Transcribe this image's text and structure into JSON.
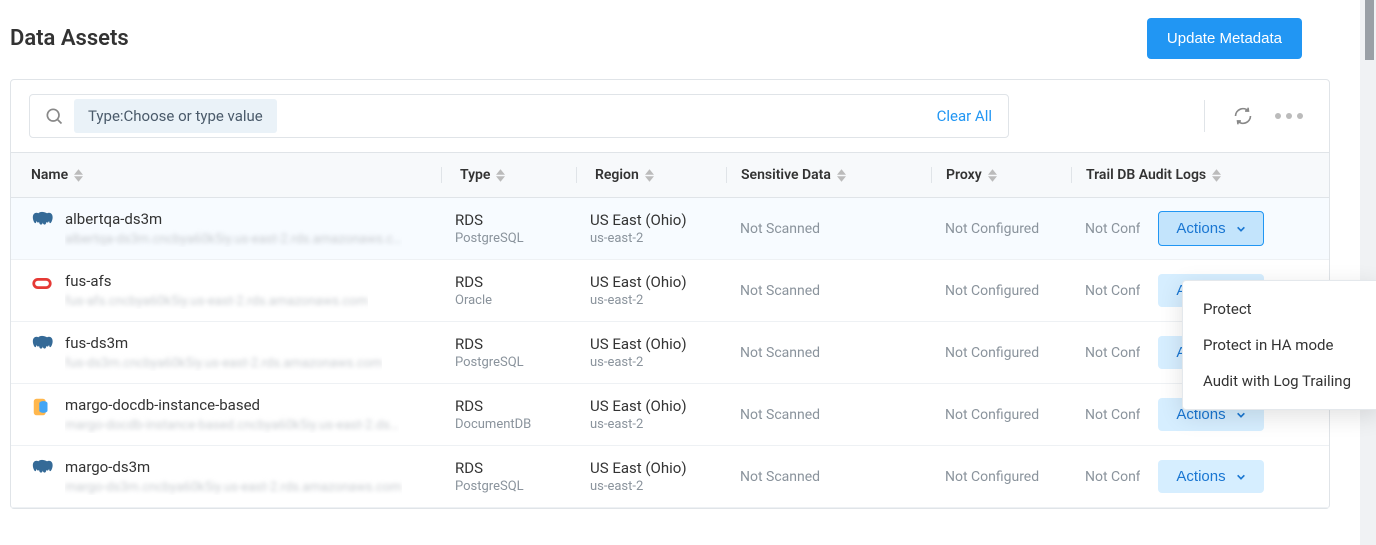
{
  "header": {
    "title": "Data Assets",
    "update_btn": "Update Metadata"
  },
  "filter": {
    "chip_prefix": "Type:",
    "chip_value": "Choose or type value",
    "clear_all": "Clear All"
  },
  "columns": {
    "name": "Name",
    "type": "Type",
    "region": "Region",
    "sensitive": "Sensitive Data",
    "proxy": "Proxy",
    "trail": "Trail DB Audit Logs"
  },
  "status": {
    "not_scanned": "Not Scanned",
    "not_configured": "Not Configured"
  },
  "actions_label": "Actions",
  "dropdown": {
    "protect": "Protect",
    "protect_ha": "Protect in HA mode",
    "audit": "Audit with Log Trailing"
  },
  "rows": [
    {
      "icon": "postgresql",
      "name": "albertqa-ds3m",
      "sub": "albertqa-ds3m.cncbya60k5iy.us-east-2.rds.amazonaws.c…",
      "type": "RDS",
      "subtype": "PostgreSQL",
      "region": "US East (Ohio)",
      "region_code": "us-east-2",
      "sensitive": "Not Scanned",
      "proxy": "Not Configured",
      "trail": "Not Configured",
      "actions_open": true
    },
    {
      "icon": "oracle",
      "name": "fus-afs",
      "sub": "fus-afs.cncbya60k5iy.us-east-2.rds.amazonaws.com",
      "type": "RDS",
      "subtype": "Oracle",
      "region": "US East (Ohio)",
      "region_code": "us-east-2",
      "sensitive": "Not Scanned",
      "proxy": "Not Configured",
      "trail": "Not Configured",
      "actions_open": false
    },
    {
      "icon": "postgresql",
      "name": "fus-ds3m",
      "sub": "fus-ds3m.cncbya60k5iy.us-east-2.rds.amazonaws.com",
      "type": "RDS",
      "subtype": "PostgreSQL",
      "region": "US East (Ohio)",
      "region_code": "us-east-2",
      "sensitive": "Not Scanned",
      "proxy": "Not Configured",
      "trail": "Not Configured",
      "actions_open": false
    },
    {
      "icon": "documentdb",
      "name": "margo-docdb-instance-based",
      "sub": "margo-docdb-instance-based.cncbya60k5iy.us-east-2.ds…",
      "type": "RDS",
      "subtype": "DocumentDB",
      "region": "US East (Ohio)",
      "region_code": "us-east-2",
      "sensitive": "Not Scanned",
      "proxy": "Not Configured",
      "trail": "Not Configured",
      "actions_open": false
    },
    {
      "icon": "postgresql",
      "name": "margo-ds3m",
      "sub": "margo-ds3m.cncbya60k5iy.us-east-2.rds.amazonaws.com",
      "type": "RDS",
      "subtype": "PostgreSQL",
      "region": "US East (Ohio)",
      "region_code": "us-east-2",
      "sensitive": "Not Scanned",
      "proxy": "Not Configured",
      "trail": "Not Configured",
      "actions_open": false
    }
  ]
}
